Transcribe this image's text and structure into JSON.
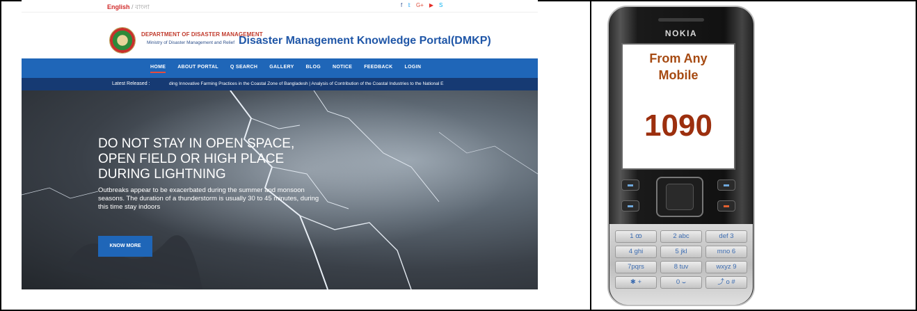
{
  "website": {
    "lang": {
      "english": "English",
      "separator": " / ",
      "bangla": "বাংলা"
    },
    "social_icons": [
      {
        "icon": "facebook-icon",
        "glyph": "f",
        "color": "#3b5998"
      },
      {
        "icon": "twitter-icon",
        "glyph": "𝕥",
        "color": "#1da1f2"
      },
      {
        "icon": "google-plus-icon",
        "glyph": "G+",
        "color": "#dd4b39"
      },
      {
        "icon": "youtube-icon",
        "glyph": "▶",
        "color": "#e52d27"
      },
      {
        "icon": "skype-icon",
        "glyph": "S",
        "color": "#00aff0"
      }
    ],
    "header": {
      "department": "DEPARTMENT OF DISASTER MANAGEMENT",
      "ministry": "Ministry of Disaster Management and Relief",
      "portal_title": "Disaster Management Knowledge Portal(DMKP)"
    },
    "nav": {
      "items": [
        "HOME",
        "ABOUT PORTAL",
        "Q SEARCH",
        "GALLERY",
        "BLOG",
        "NOTICE",
        "FEEDBACK",
        "LOGIN"
      ],
      "active": "HOME"
    },
    "ticker": {
      "label": "Latest Released :",
      "text": "ding Innovative Farming Practices in the Coastal Zone of Bangladesh    |    Analysis of Contribution of the Coastal Industries to the National E"
    },
    "hero": {
      "heading_lines": [
        "DO NOT STAY IN OPEN SPACE,",
        "OPEN FIELD OR HIGH PLACE",
        "DURING LIGHTNING"
      ],
      "body": "Outbreaks appear to be exacerbated during the summer and monsoon seasons. The duration of a thunderstorm is usually 30 to 45 minutes, during this time stay indoors",
      "button": "KNOW MORE"
    },
    "colors": {
      "nav": "#1f66b8",
      "ticker": "#163a73",
      "title": "#1f56a7"
    }
  },
  "phone": {
    "brand": "NOKIA",
    "screen_line1": "From Any",
    "screen_line2": "Mobile",
    "number": "1090",
    "keys": [
      "1 ꝏ",
      "2 abc",
      "def 3",
      "4 ghi",
      "5 jkl",
      "mno 6",
      "7pqrs",
      "8 tuv",
      "wxyz 9",
      "✱ +",
      "0 ⌣",
      "⤴ o #"
    ]
  }
}
